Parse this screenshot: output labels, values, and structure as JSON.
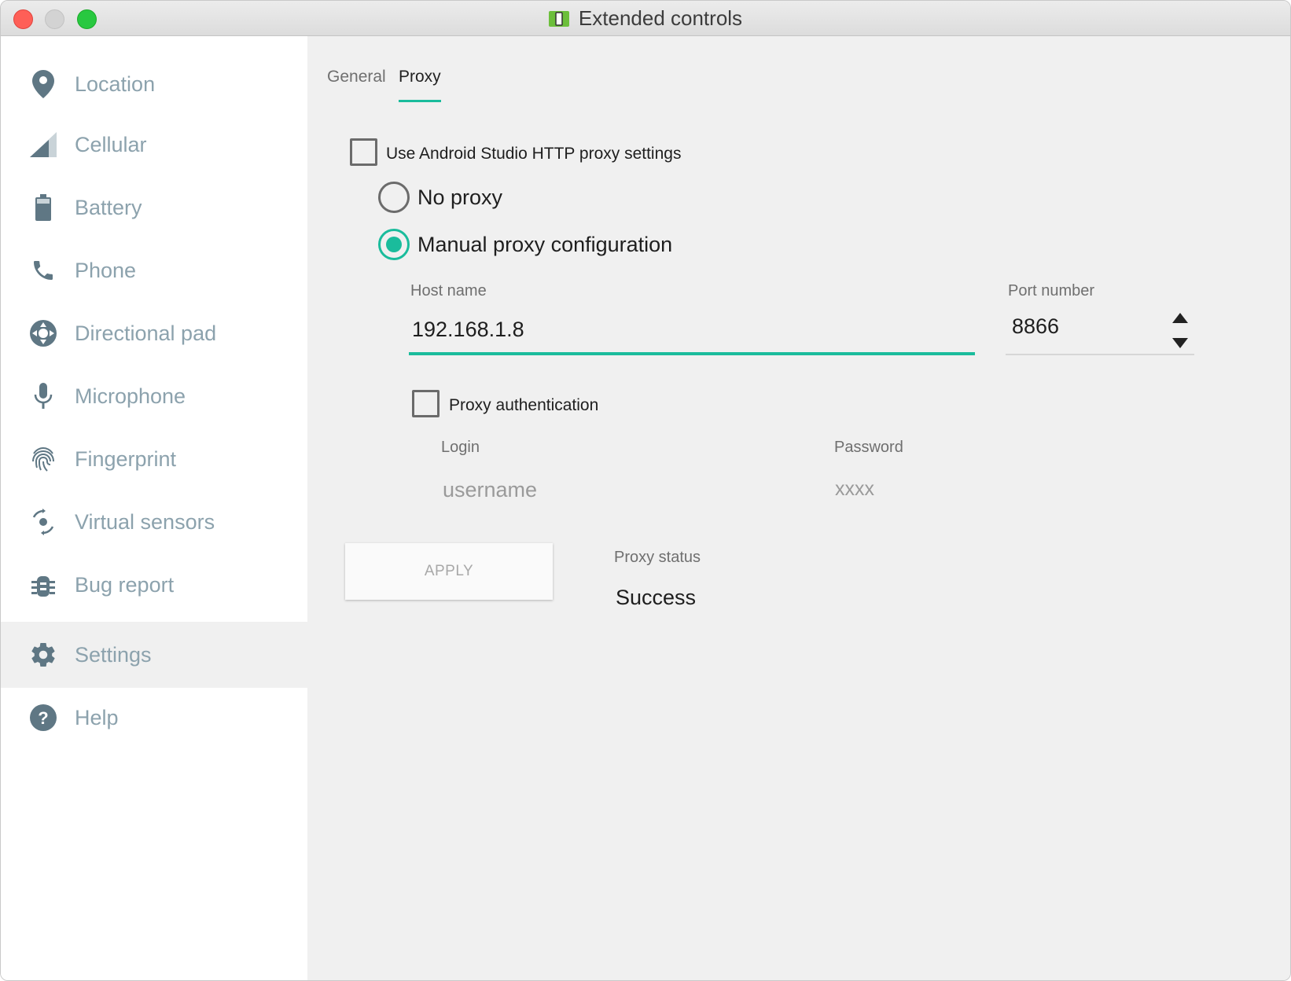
{
  "window": {
    "title": "Extended controls"
  },
  "sidebar": {
    "items": [
      {
        "label": "Location",
        "icon": "location-pin-icon"
      },
      {
        "label": "Cellular",
        "icon": "cellular-signal-icon"
      },
      {
        "label": "Battery",
        "icon": "battery-icon"
      },
      {
        "label": "Phone",
        "icon": "phone-icon"
      },
      {
        "label": "Directional pad",
        "icon": "dpad-icon"
      },
      {
        "label": "Microphone",
        "icon": "microphone-icon"
      },
      {
        "label": "Fingerprint",
        "icon": "fingerprint-icon"
      },
      {
        "label": "Virtual sensors",
        "icon": "rotation-icon"
      },
      {
        "label": "Bug report",
        "icon": "bug-icon"
      },
      {
        "label": "Settings",
        "icon": "gear-icon"
      },
      {
        "label": "Help",
        "icon": "help-icon"
      }
    ],
    "active_index": 9
  },
  "tabs": [
    {
      "label": "General"
    },
    {
      "label": "Proxy"
    }
  ],
  "active_tab": "Proxy",
  "proxy": {
    "use_studio_label": "Use Android Studio HTTP proxy settings",
    "use_studio_checked": false,
    "no_proxy_label": "No proxy",
    "manual_label": "Manual proxy configuration",
    "selected_mode": "Manual proxy configuration",
    "host_label": "Host name",
    "host_value": "192.168.1.8",
    "port_label": "Port number",
    "port_value": "8866",
    "auth_label": "Proxy authentication",
    "auth_checked": false,
    "login_label": "Login",
    "login_placeholder": "username",
    "password_label": "Password",
    "password_placeholder": "xxxx",
    "apply_label": "APPLY",
    "status_label": "Proxy status",
    "status_value": "Success"
  },
  "colors": {
    "accent": "#1abc9c",
    "sidebar_text": "#8ca2ad",
    "sidebar_icon": "#5f7784"
  }
}
